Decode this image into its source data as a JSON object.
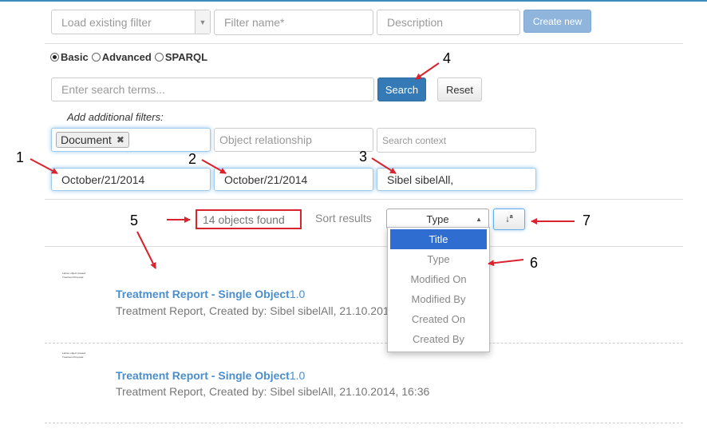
{
  "filter_bar": {
    "load_filter_placeholder": "Load existing filter",
    "filter_name_placeholder": "Filter name*",
    "description_placeholder": "Description",
    "create_new_label": "Create new"
  },
  "search_mode": {
    "options": [
      "Basic",
      "Advanced",
      "SPARQL"
    ],
    "selected": "Basic"
  },
  "search": {
    "placeholder": "Enter search terms...",
    "search_label": "Search",
    "reset_label": "Reset"
  },
  "filters": {
    "heading": "Add additional filters:",
    "type_tag": "Document",
    "relationship_placeholder": "Object relationship",
    "context_placeholder": "Search context",
    "date_from": "October/21/2014",
    "date_to": "October/21/2014",
    "created_by": "Sibel sibelAll,"
  },
  "results": {
    "count_label": "14 objects found",
    "sort_label": "Sort results",
    "sort_selected": "Type",
    "sort_options": [
      "Title",
      "Type",
      "Modified On",
      "Modified By",
      "Created On",
      "Created By"
    ],
    "sort_highlighted": "Title",
    "items": [
      {
        "title": "Treatment Report - Single Object",
        "version": "1.0",
        "meta": "Treatment Report, Created by: Sibel sibelAll, 21.10.2014, 16:36",
        "thumb_lines": [
          "Labour object created",
          "Treatment Proposal"
        ]
      },
      {
        "title": "Treatment Report - Single Object",
        "version": "1.0",
        "meta": "Treatment Report, Created by: Sibel sibelAll, 21.10.2014, 16:36",
        "thumb_lines": [
          "Labour object created",
          "Treatment Proposal"
        ]
      }
    ]
  },
  "annotations": [
    "1",
    "2",
    "3",
    "4",
    "5",
    "6",
    "7"
  ],
  "colors": {
    "annotation_red": "#d9232e",
    "primary": "#337ab7",
    "highlight": "#2f6ed0",
    "link": "#4a8ecb"
  }
}
